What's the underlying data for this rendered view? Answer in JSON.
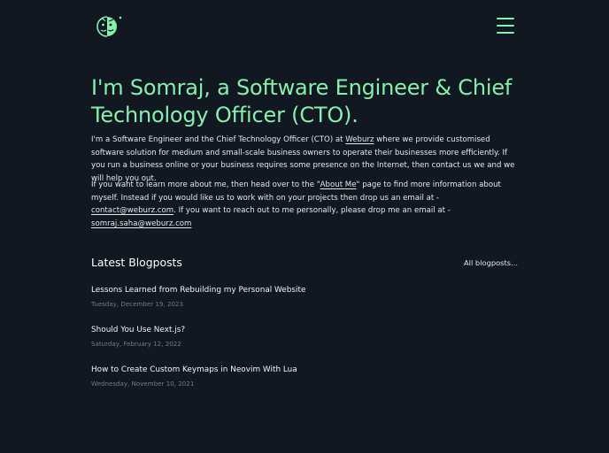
{
  "header": {
    "logo_icon": "half-face-avatar-logo-icon",
    "menu_icon": "hamburger-menu-icon",
    "accent_color": "#86efac"
  },
  "hero": {
    "title": "I'm Somraj, a Software Engineer & Chief Technology Officer (CTO).",
    "p1_before": "I'm a Software Engineer and the Chief Technology Officer (CTO) at ",
    "p1_link": "Weburz",
    "p1_after": " where we provide customised software solution for medium and small-scale business owners to operate their businesses more efficiently. If you run a business online or your business requires some presence on the Internet, then contact us we and we will help you out.",
    "p2_before": "If you want to learn more about me, then head over to the \"",
    "p2_about_link": "About Me",
    "p2_middle": "\" page to find more information about myself. Instead if you would like us to work with on your projects then drop us an email at - ",
    "p2_contact_email": "contact@weburz.com",
    "p2_after": ". If you want to reach out to me personally, please drop me an email at - ",
    "p2_personal_email": "somraj.saha@weburz.com"
  },
  "blog": {
    "section_title": "Latest Blogposts",
    "all_link": "All blogposts...",
    "posts": [
      {
        "title": "Lessons Learned from Rebuilding my Personal Website",
        "date": "Tuesday, December 19, 2023"
      },
      {
        "title": "Should You Use Next.js?",
        "date": "Saturday, February 12, 2022"
      },
      {
        "title": "How to Create Custom Keymaps in Neovim With Lua",
        "date": "Wednesday, November 10, 2021"
      }
    ]
  }
}
